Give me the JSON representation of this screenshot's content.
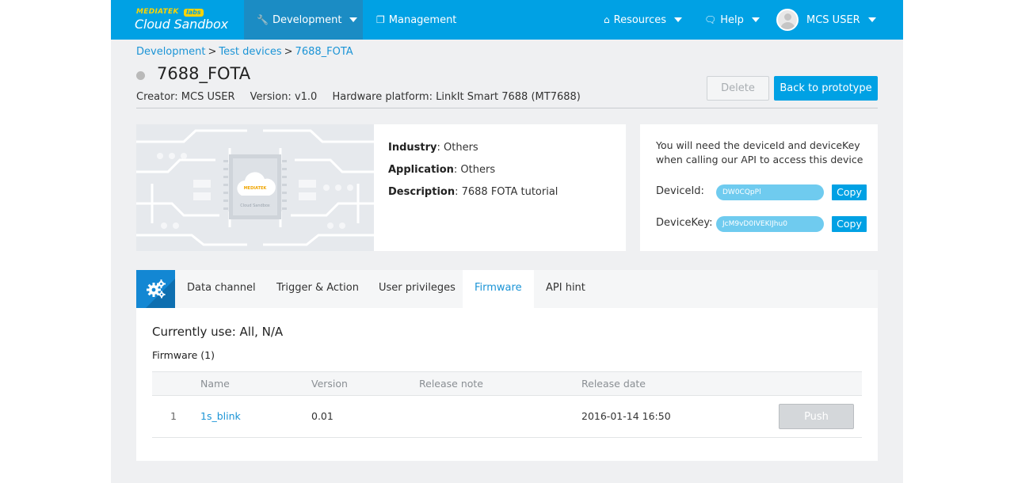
{
  "brand": {
    "maker": "MEDIATEK",
    "labs": "labs",
    "product": "Cloud Sandbox"
  },
  "nav": {
    "development": "Development",
    "management": "Management",
    "resources": "Resources",
    "help": "Help",
    "user": "MCS USER"
  },
  "breadcrumb": {
    "items": [
      "Development",
      "Test devices",
      "7688_FOTA"
    ],
    "separator": ">"
  },
  "device": {
    "name": "7688_FOTA",
    "status_color": "#b9b9b9",
    "creator": "Creator: MCS USER",
    "version": "Version: v1.0",
    "platform": "Hardware platform: LinkIt Smart 7688 (MT7688)"
  },
  "actions": {
    "delete": "Delete",
    "back": "Back to prototype"
  },
  "info": {
    "industry_label": "Industry",
    "industry_value": ": Others",
    "application_label": "Application",
    "application_value": ": Others",
    "description_label": "Description",
    "description_value": ": 7688 FOTA tutorial",
    "board_logo": "MEDIATEK",
    "board_caption": "Cloud Sandbox"
  },
  "keys": {
    "hint": "You will need the deviceId and deviceKey when calling our API to access this device",
    "device_id_label": "DeviceId:",
    "device_id_value": "DW0CQpPl",
    "device_key_label": "DeviceKey:",
    "device_key_value": "JcM9vD0IVEKIJhu0",
    "copy": "Copy"
  },
  "tabs": [
    "Data channel",
    "Trigger & Action",
    "User privileges",
    "Firmware",
    "API hint"
  ],
  "firmware": {
    "currently": "Currently use: All, N/A",
    "count": "Firmware (1)",
    "columns": [
      "Name",
      "Version",
      "Release note",
      "Release date"
    ],
    "rows": [
      {
        "index": "1",
        "name": "1s_blink",
        "version": "0.01",
        "note": "",
        "date": "2016-01-14 16:50",
        "action": "Push"
      }
    ]
  },
  "colors": {
    "primary": "#00a1e4",
    "link": "#1b94d6",
    "background": "#eff0f2"
  }
}
